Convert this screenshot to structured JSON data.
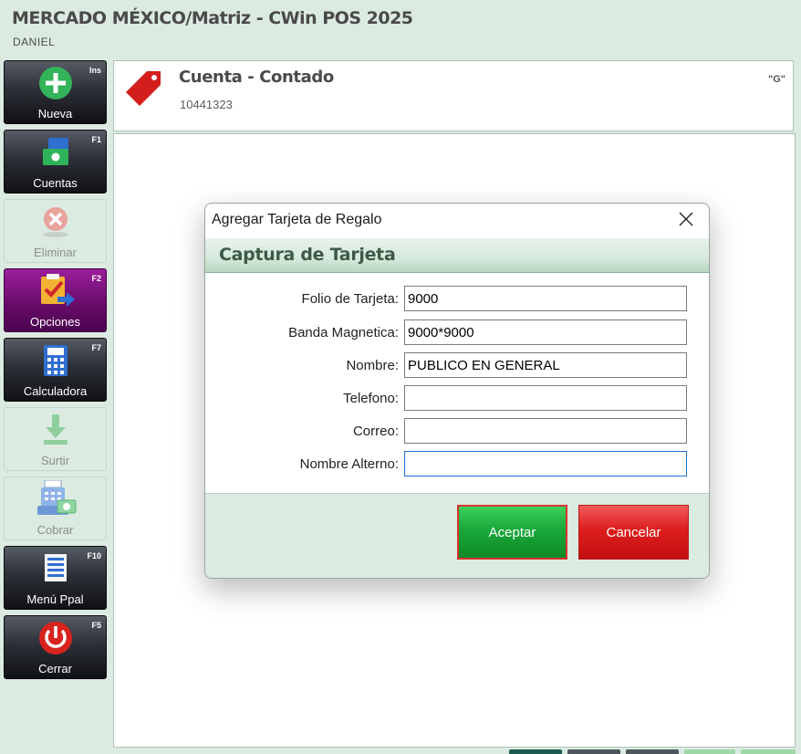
{
  "app": {
    "title": "MERCADO MÉXICO/Matriz - CWin POS 2025",
    "user": "DANIEL"
  },
  "sidebar": {
    "items": [
      {
        "label": "Nueva",
        "key": "Ins",
        "icon": "plus-circle-icon",
        "enabled": true
      },
      {
        "label": "Cuentas",
        "key": "F1",
        "icon": "money-card-icon",
        "enabled": true
      },
      {
        "label": "Eliminar",
        "key": "",
        "icon": "delete-circle-icon",
        "enabled": false
      },
      {
        "label": "Opciones",
        "key": "F2",
        "icon": "options-checklist-icon",
        "enabled": true
      },
      {
        "label": "Calculadora",
        "key": "F7",
        "icon": "calculator-icon",
        "enabled": true
      },
      {
        "label": "Surtir",
        "key": "",
        "icon": "download-arrow-icon",
        "enabled": false
      },
      {
        "label": "Cobrar",
        "key": "",
        "icon": "cash-register-icon",
        "enabled": false
      },
      {
        "label": "Menú Ppal",
        "key": "F10",
        "icon": "menu-document-icon",
        "enabled": true
      },
      {
        "label": "Cerrar",
        "key": "F5",
        "icon": "power-icon",
        "enabled": true
      }
    ]
  },
  "account": {
    "title": "Cuenta - Contado",
    "number": "10441323",
    "code": "\"G\"",
    "icon": "price-tag-icon"
  },
  "dialog": {
    "title": "Agregar Tarjeta de Regalo",
    "header": "Captura de Tarjeta",
    "fields": [
      {
        "label": "Folio de Tarjeta:",
        "value": "9000"
      },
      {
        "label": "Banda Magnetica:",
        "value": "9000*9000"
      },
      {
        "label": "Nombre:",
        "value": "PUBLICO EN GENERAL"
      },
      {
        "label": "Telefono:",
        "value": ""
      },
      {
        "label": "Correo:",
        "value": ""
      },
      {
        "label": "Nombre Alterno:",
        "value": ""
      }
    ],
    "accept_label": "Aceptar",
    "cancel_label": "Cancelar"
  },
  "colors": {
    "background": "#dcebe1",
    "accept": "#1aa83a",
    "cancel": "#dd1e1e",
    "tag": "#d41e1e"
  }
}
